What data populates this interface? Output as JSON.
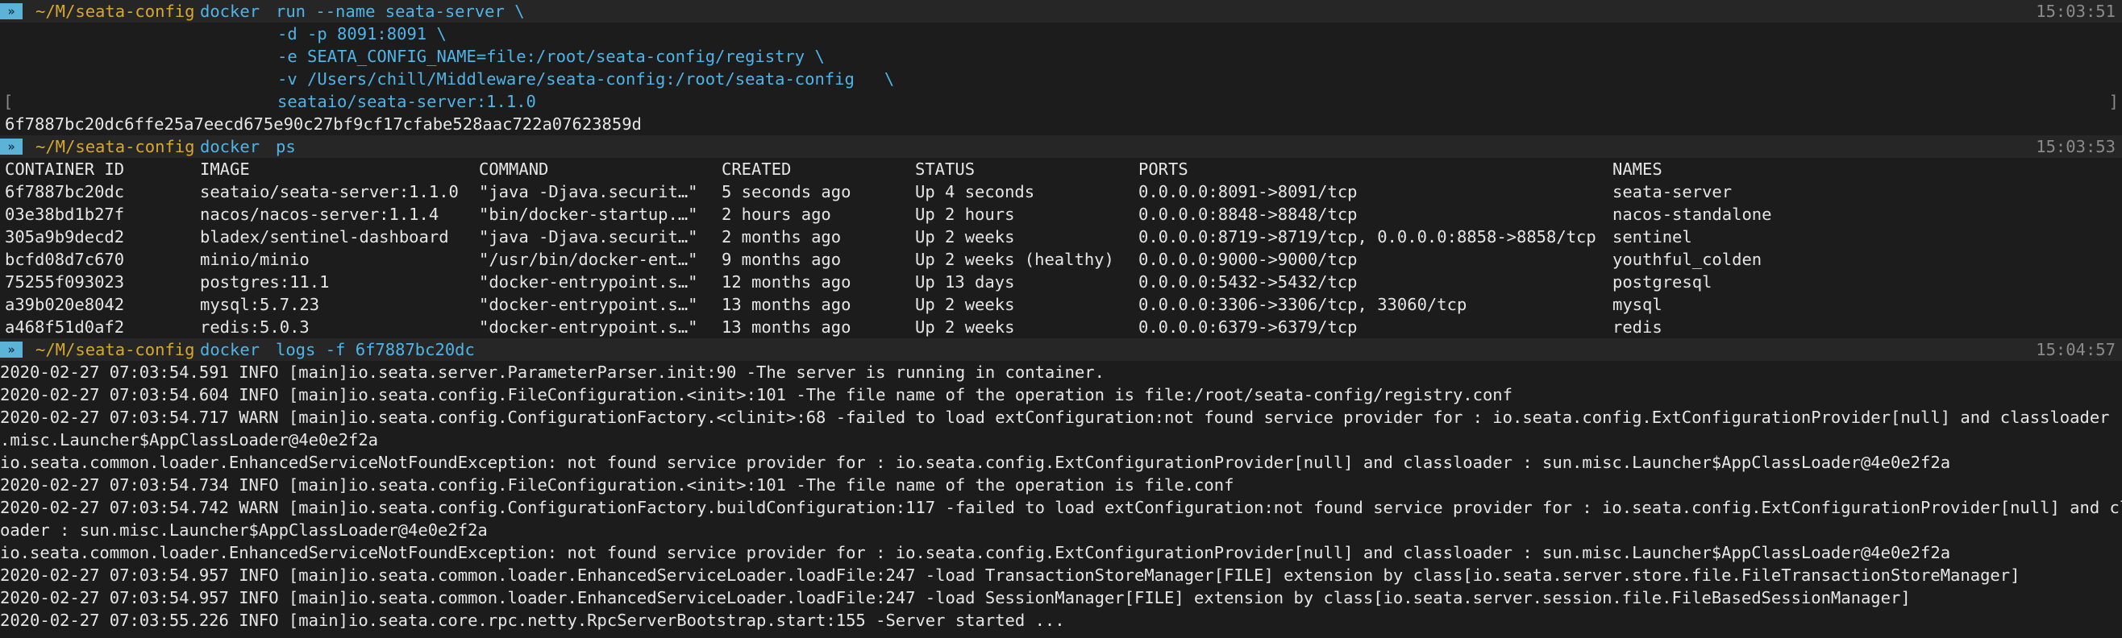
{
  "prompts": [
    {
      "path": "~/M/seata-config",
      "command": "docker",
      "rest": "run --name seata-server \\",
      "time": "15:03:51"
    },
    {
      "path": "~/M/seata-config",
      "command": "docker",
      "rest": "ps",
      "time": "15:03:53"
    },
    {
      "path": "~/M/seata-config",
      "command": "docker",
      "rest": "logs -f 6f7887bc20dc",
      "time": "15:04:57"
    }
  ],
  "run_args": [
    "-d -p 8091:8091 \\",
    "-e SEATA_CONFIG_NAME=file:/root/seata-config/registry \\",
    "-v /Users/chill/Middleware/seata-config:/root/seata-config   \\",
    "seataio/seata-server:1.1.0"
  ],
  "bracket_left": "[",
  "bracket_right": "]",
  "container_hash": "6f7887bc20dc6ffe25a7eecd675e90c27bf9cf17cfabe528aac722a07623859d",
  "ps_table": {
    "headers": [
      "CONTAINER ID",
      "IMAGE",
      "COMMAND",
      "CREATED",
      "STATUS",
      "PORTS",
      "NAMES"
    ],
    "rows": [
      [
        "6f7887bc20dc",
        "seataio/seata-server:1.1.0",
        "\"java -Djava.securit…\"",
        "5 seconds ago",
        "Up 4 seconds",
        "0.0.0.0:8091->8091/tcp",
        "seata-server"
      ],
      [
        "03e38bd1b27f",
        "nacos/nacos-server:1.1.4",
        "\"bin/docker-startup.…\"",
        "2 hours ago",
        "Up 2 hours",
        "0.0.0.0:8848->8848/tcp",
        "nacos-standalone"
      ],
      [
        "305a9b9decd2",
        "bladex/sentinel-dashboard",
        "\"java -Djava.securit…\"",
        "2 months ago",
        "Up 2 weeks",
        "0.0.0.0:8719->8719/tcp, 0.0.0.0:8858->8858/tcp",
        "sentinel"
      ],
      [
        "bcfd08d7c670",
        "minio/minio",
        "\"/usr/bin/docker-ent…\"",
        "9 months ago",
        "Up 2 weeks (healthy)",
        "0.0.0.0:9000->9000/tcp",
        "youthful_colden"
      ],
      [
        "75255f093023",
        "postgres:11.1",
        "\"docker-entrypoint.s…\"",
        "12 months ago",
        "Up 13 days",
        "0.0.0.0:5432->5432/tcp",
        "postgresql"
      ],
      [
        "a39b020e8042",
        "mysql:5.7.23",
        "\"docker-entrypoint.s…\"",
        "13 months ago",
        "Up 2 weeks",
        "0.0.0.0:3306->3306/tcp, 33060/tcp",
        "mysql"
      ],
      [
        "a468f51d0af2",
        "redis:5.0.3",
        "\"docker-entrypoint.s…\"",
        "13 months ago",
        "Up 2 weeks",
        "0.0.0.0:6379->6379/tcp",
        "redis"
      ]
    ]
  },
  "log_lines": [
    "2020-02-27 07:03:54.591 INFO [main]io.seata.server.ParameterParser.init:90 -The server is running in container.",
    "2020-02-27 07:03:54.604 INFO [main]io.seata.config.FileConfiguration.<init>:101 -The file name of the operation is file:/root/seata-config/registry.conf",
    "2020-02-27 07:03:54.717 WARN [main]io.seata.config.ConfigurationFactory.<clinit>:68 -failed to load extConfiguration:not found service provider for : io.seata.config.ExtConfigurationProvider[null] and classloader : sun",
    ".misc.Launcher$AppClassLoader@4e0e2f2a",
    "io.seata.common.loader.EnhancedServiceNotFoundException: not found service provider for : io.seata.config.ExtConfigurationProvider[null] and classloader : sun.misc.Launcher$AppClassLoader@4e0e2f2a",
    "2020-02-27 07:03:54.734 INFO [main]io.seata.config.FileConfiguration.<init>:101 -The file name of the operation is file.conf",
    "2020-02-27 07:03:54.742 WARN [main]io.seata.config.ConfigurationFactory.buildConfiguration:117 -failed to load extConfiguration:not found service provider for : io.seata.config.ExtConfigurationProvider[null] and classl",
    "oader : sun.misc.Launcher$AppClassLoader@4e0e2f2a",
    "io.seata.common.loader.EnhancedServiceNotFoundException: not found service provider for : io.seata.config.ExtConfigurationProvider[null] and classloader : sun.misc.Launcher$AppClassLoader@4e0e2f2a",
    "2020-02-27 07:03:54.957 INFO [main]io.seata.common.loader.EnhancedServiceLoader.loadFile:247 -load TransactionStoreManager[FILE] extension by class[io.seata.server.store.file.FileTransactionStoreManager]",
    "2020-02-27 07:03:54.957 INFO [main]io.seata.common.loader.EnhancedServiceLoader.loadFile:247 -load SessionManager[FILE] extension by class[io.seata.server.session.file.FileBasedSessionManager]",
    "2020-02-27 07:03:55.226 INFO [main]io.seata.core.rpc.netty.RpcServerBootstrap.start:155 -Server started ..."
  ],
  "icons": {
    "prompt_badge": "terminal-prompt-icon",
    "badge_glyph": "»"
  },
  "colors": {
    "background": "#1c1c1c",
    "path": "#d9a82e",
    "command": "#4fb4e8",
    "timestamp": "#8a8a8a",
    "text": "#e6e6e6"
  }
}
